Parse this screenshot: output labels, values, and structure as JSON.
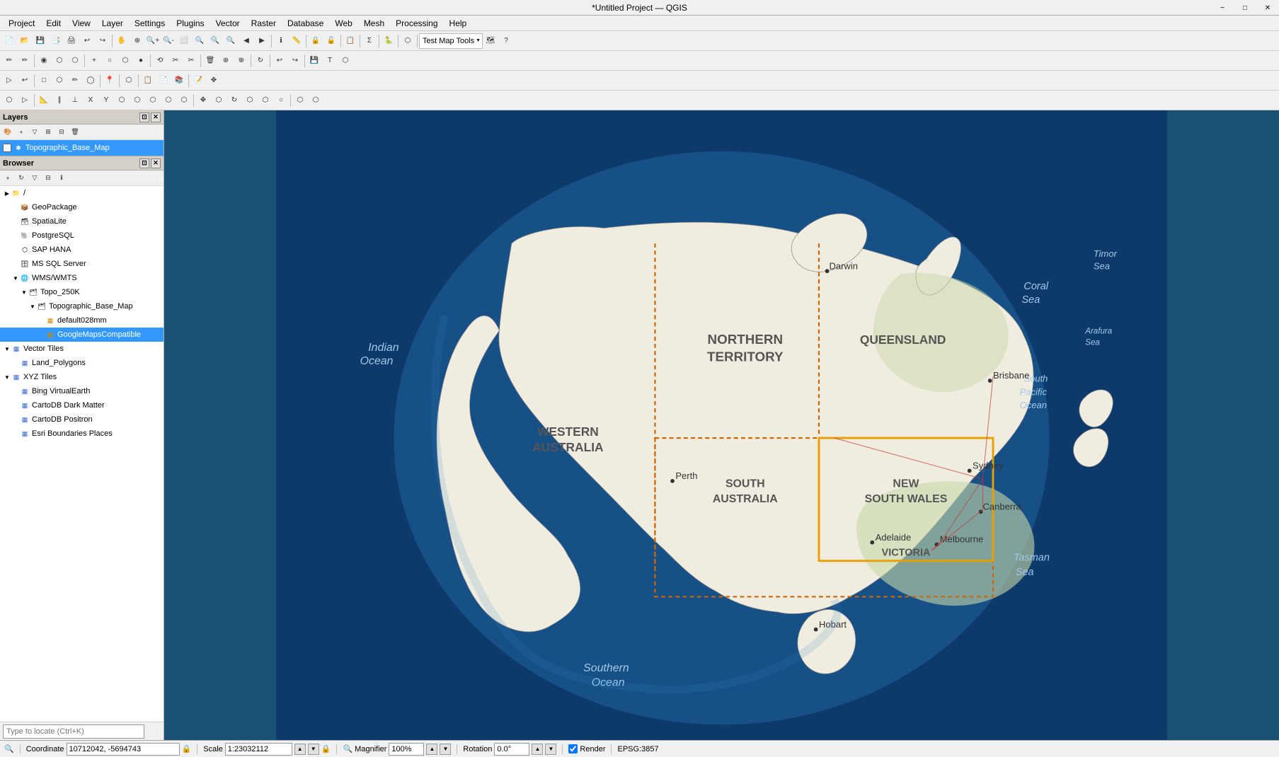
{
  "titlebar": {
    "title": "*Untitled Project — QGIS",
    "min": "−",
    "max": "□",
    "close": "✕"
  },
  "menubar": {
    "items": [
      "Project",
      "Edit",
      "View",
      "Layer",
      "Settings",
      "Plugins",
      "Vector",
      "Raster",
      "Database",
      "Web",
      "Mesh",
      "Processing",
      "Help"
    ]
  },
  "layers_panel": {
    "title": "Layers",
    "layer": {
      "name": "Topographic_Base_Map",
      "checked": true
    }
  },
  "browser_panel": {
    "title": "Browser",
    "items": [
      {
        "id": "root",
        "label": "/",
        "indent": 0,
        "arrow": "▶",
        "icon": "📁",
        "expanded": false
      },
      {
        "id": "geopackage",
        "label": "GeoPackage",
        "indent": 1,
        "arrow": "",
        "icon": "📦",
        "expanded": false
      },
      {
        "id": "spatialite",
        "label": "SpatiaLite",
        "indent": 1,
        "arrow": "",
        "icon": "🗃",
        "expanded": false
      },
      {
        "id": "postgresql",
        "label": "PostgreSQL",
        "indent": 1,
        "arrow": "",
        "icon": "🐘",
        "expanded": false
      },
      {
        "id": "saphana",
        "label": "SAP HANA",
        "indent": 1,
        "arrow": "",
        "icon": "⬡",
        "expanded": false
      },
      {
        "id": "mssql",
        "label": "MS SQL Server",
        "indent": 1,
        "arrow": "",
        "icon": "🗄",
        "expanded": false
      },
      {
        "id": "wmswmts",
        "label": "WMS/WMTS",
        "indent": 1,
        "arrow": "▼",
        "icon": "🌐",
        "expanded": true
      },
      {
        "id": "topo250k",
        "label": "Topo_250K",
        "indent": 2,
        "arrow": "▼",
        "icon": "🗂",
        "expanded": true
      },
      {
        "id": "topographic_base_map",
        "label": "Topographic_Base_Map",
        "indent": 3,
        "arrow": "▼",
        "icon": "🗂",
        "expanded": true
      },
      {
        "id": "default028mm",
        "label": "default028mm",
        "indent": 4,
        "arrow": "",
        "icon": "▦",
        "expanded": false
      },
      {
        "id": "googlemapscompat",
        "label": "GoogleMapsCompatible",
        "indent": 4,
        "arrow": "",
        "icon": "▦",
        "expanded": false,
        "selected": true
      },
      {
        "id": "vector_tiles",
        "label": "Vector Tiles",
        "indent": 0,
        "arrow": "▼",
        "icon": "⬡⬡",
        "expanded": true
      },
      {
        "id": "land_polygons",
        "label": "Land_Polygons",
        "indent": 1,
        "arrow": "",
        "icon": "⬡⬡",
        "expanded": false
      },
      {
        "id": "xyz_tiles",
        "label": "XYZ Tiles",
        "indent": 0,
        "arrow": "▼",
        "icon": "⬡⬡",
        "expanded": true
      },
      {
        "id": "bing_virtual",
        "label": "Bing VirtualEarth",
        "indent": 1,
        "arrow": "",
        "icon": "⬡⬡",
        "expanded": false
      },
      {
        "id": "cartodb_dark",
        "label": "CartoDB Dark Matter",
        "indent": 1,
        "arrow": "",
        "icon": "⬡⬡",
        "expanded": false
      },
      {
        "id": "cartodb_positron",
        "label": "CartoDB Positron",
        "indent": 1,
        "arrow": "",
        "icon": "⬡⬡",
        "expanded": false
      },
      {
        "id": "esri_boundaries",
        "label": "Esri Boundaries Places",
        "indent": 1,
        "arrow": "",
        "icon": "⬡⬡",
        "expanded": false
      }
    ]
  },
  "statusbar": {
    "coordinate_label": "Coordinate",
    "coordinate_value": "10712042, -5694743",
    "scale_label": "Scale",
    "scale_value": "1:23032112",
    "magnifier_label": "Magnifier",
    "magnifier_value": "100%",
    "rotation_label": "Rotation",
    "rotation_value": "0.0°",
    "render_label": "Render",
    "crs_value": "EPSG:3857"
  },
  "searchbar": {
    "placeholder": "Type to locate (Ctrl+K)"
  },
  "toolbar1": {
    "buttons": [
      "💾",
      "📂",
      "💾",
      "⬛",
      "🖨",
      "⚡",
      "📋",
      "📊",
      "🔍",
      "🔍",
      "🔍",
      "🔍",
      "🗺",
      "🔍",
      "🔍",
      "⬛",
      "🔒",
      "🔒",
      "⬜",
      "⬜",
      "⏱",
      "🔄",
      "",
      "",
      "",
      "",
      "",
      "",
      "🎯",
      "⬛",
      "💡",
      "🔍",
      "📐",
      "Σ",
      "⬛",
      "",
      "🔍",
      "💬"
    ]
  },
  "map": {
    "background_ocean": "#1a5276",
    "background_shallow": "#2e86c1",
    "land_color": "#f5f5dc",
    "boundary_color": "#cc6600",
    "state_boundary_color": "#cc6600",
    "highlight_color": "#e8a000"
  }
}
